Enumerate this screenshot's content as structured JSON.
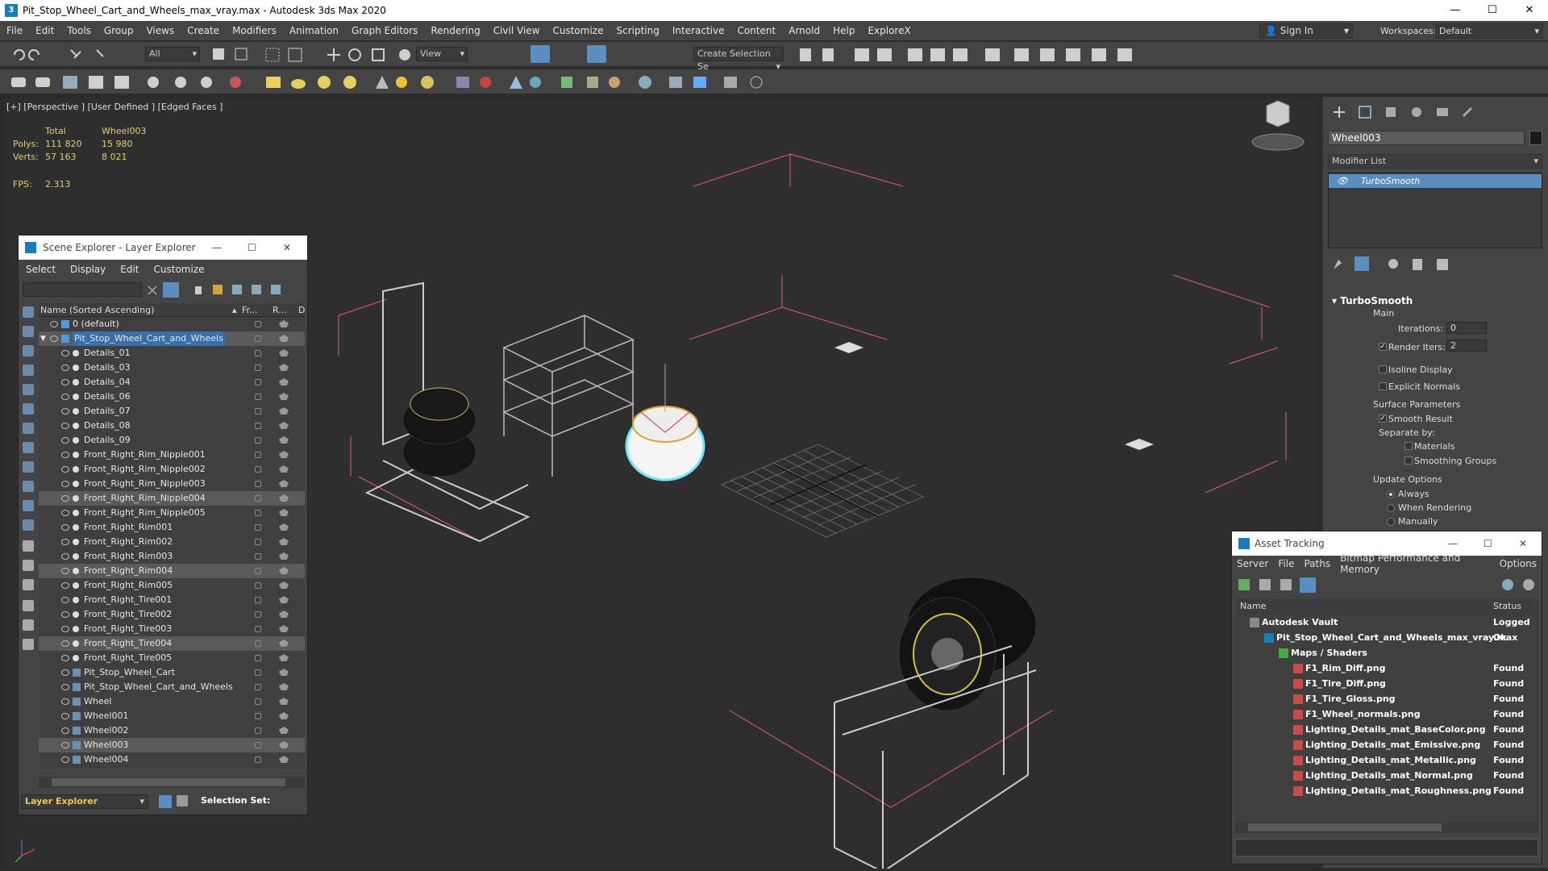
{
  "window": {
    "title": "Pit_Stop_Wheel_Cart_and_Wheels_max_vray.max - Autodesk 3ds Max 2020",
    "app_icon": "3"
  },
  "menu": [
    "File",
    "Edit",
    "Tools",
    "Group",
    "Views",
    "Create",
    "Modifiers",
    "Animation",
    "Graph Editors",
    "Rendering",
    "Civil View",
    "Customize",
    "Scripting",
    "Interactive",
    "Content",
    "Arnold",
    "Help",
    "ExploreX"
  ],
  "signin": {
    "label": "Sign In"
  },
  "workspaces": {
    "label": "Workspaces:",
    "value": "Default"
  },
  "toolbar": {
    "selection_filter": "All",
    "ref_coord": "View",
    "create_selection_set": "Create Selection Se"
  },
  "viewport": {
    "label": "[+] [Perspective ] [User Defined ] [Edged Faces ]",
    "stats": {
      "total_label": "Total",
      "object_label": "Wheel003",
      "polys_label": "Polys:",
      "polys_total": "111 820",
      "polys_obj": "15 980",
      "verts_label": "Verts:",
      "verts_total": "57 163",
      "verts_obj": "8 021",
      "fps_label": "FPS:",
      "fps_value": "2.313"
    }
  },
  "command_panel": {
    "object_name": "Wheel003",
    "modifier_list": "Modifier List",
    "stack_item": "TurboSmooth",
    "rollout": "TurboSmooth",
    "main_label": "Main",
    "iterations_label": "Iterations:",
    "iterations_value": "0",
    "render_iters_label": "Render Iters:",
    "render_iters_value": "2",
    "isoline_display": "Isoline Display",
    "explicit_normals": "Explicit Normals",
    "surface_parameters": "Surface Parameters",
    "smooth_result": "Smooth Result",
    "separate_by": "Separate by:",
    "materials": "Materials",
    "smoothing_groups": "Smoothing Groups",
    "update_options": "Update Options",
    "always": "Always",
    "when_rendering": "When Rendering",
    "manually": "Manually"
  },
  "scene_explorer": {
    "title": "Scene Explorer - Layer Explorer",
    "menu": [
      "Select",
      "Display",
      "Edit",
      "Customize"
    ],
    "col_name": "Name (Sorted Ascending)",
    "col_fr": "Fr...",
    "col_r": "R...",
    "col_d": "D",
    "rows": [
      {
        "name": "0 (default)",
        "indent": 0,
        "hl": false,
        "layer": true
      },
      {
        "name": "Pit_Stop_Wheel_Cart_and_Wheels",
        "indent": 0,
        "hl": true,
        "layer": true
      },
      {
        "name": "Details_01",
        "indent": 1,
        "hl": false
      },
      {
        "name": "Details_03",
        "indent": 1,
        "hl": false
      },
      {
        "name": "Details_04",
        "indent": 1,
        "hl": false
      },
      {
        "name": "Details_06",
        "indent": 1,
        "hl": false
      },
      {
        "name": "Details_07",
        "indent": 1,
        "hl": false
      },
      {
        "name": "Details_08",
        "indent": 1,
        "hl": false
      },
      {
        "name": "Details_09",
        "indent": 1,
        "hl": false
      },
      {
        "name": "Front_Right_Rim_Nipple001",
        "indent": 1,
        "hl": false
      },
      {
        "name": "Front_Right_Rim_Nipple002",
        "indent": 1,
        "hl": false
      },
      {
        "name": "Front_Right_Rim_Nipple003",
        "indent": 1,
        "hl": false
      },
      {
        "name": "Front_Right_Rim_Nipple004",
        "indent": 1,
        "hl": true
      },
      {
        "name": "Front_Right_Rim_Nipple005",
        "indent": 1,
        "hl": false
      },
      {
        "name": "Front_Right_Rim001",
        "indent": 1,
        "hl": false
      },
      {
        "name": "Front_Right_Rim002",
        "indent": 1,
        "hl": false
      },
      {
        "name": "Front_Right_Rim003",
        "indent": 1,
        "hl": false
      },
      {
        "name": "Front_Right_Rim004",
        "indent": 1,
        "hl": true
      },
      {
        "name": "Front_Right_Rim005",
        "indent": 1,
        "hl": false
      },
      {
        "name": "Front_Right_Tire001",
        "indent": 1,
        "hl": false
      },
      {
        "name": "Front_Right_Tire002",
        "indent": 1,
        "hl": false
      },
      {
        "name": "Front_Right_Tire003",
        "indent": 1,
        "hl": false
      },
      {
        "name": "Front_Right_Tire004",
        "indent": 1,
        "hl": true
      },
      {
        "name": "Front_Right_Tire005",
        "indent": 1,
        "hl": false
      },
      {
        "name": "Pit_Stop_Wheel_Cart",
        "indent": 1,
        "hl": false,
        "obj": true
      },
      {
        "name": "Pit_Stop_Wheel_Cart_and_Wheels",
        "indent": 1,
        "hl": false,
        "obj": true
      },
      {
        "name": "Wheel",
        "indent": 1,
        "hl": false,
        "obj": true
      },
      {
        "name": "Wheel001",
        "indent": 1,
        "hl": false,
        "obj": true
      },
      {
        "name": "Wheel002",
        "indent": 1,
        "hl": false,
        "obj": true
      },
      {
        "name": "Wheel003",
        "indent": 1,
        "hl": true,
        "obj": true
      },
      {
        "name": "Wheel004",
        "indent": 1,
        "hl": false,
        "obj": true
      }
    ],
    "bottom_combo": "Layer Explorer",
    "selection_set_label": "Selection Set:"
  },
  "asset_tracking": {
    "title": "Asset Tracking",
    "menu": [
      "Server",
      "File",
      "Paths",
      "Bitmap Performance and Memory",
      "Options"
    ],
    "col_name": "Name",
    "col_status": "Status",
    "rows": [
      {
        "name": "Autodesk Vault",
        "status": "Logged Or",
        "indent": 1,
        "kind": "vault"
      },
      {
        "name": "Pit_Stop_Wheel_Cart_and_Wheels_max_vray.max",
        "status": "Ok",
        "indent": 2,
        "kind": "max"
      },
      {
        "name": "Maps / Shaders",
        "status": "",
        "indent": 3,
        "kind": "folder"
      },
      {
        "name": "F1_Rim_Diff.png",
        "status": "Found",
        "indent": 4,
        "kind": "png"
      },
      {
        "name": "F1_Tire_Diff.png",
        "status": "Found",
        "indent": 4,
        "kind": "png"
      },
      {
        "name": "F1_Tire_Gloss.png",
        "status": "Found",
        "indent": 4,
        "kind": "png"
      },
      {
        "name": "F1_Wheel_normals.png",
        "status": "Found",
        "indent": 4,
        "kind": "png"
      },
      {
        "name": "Lighting_Details_mat_BaseColor.png",
        "status": "Found",
        "indent": 4,
        "kind": "png"
      },
      {
        "name": "Lighting_Details_mat_Emissive.png",
        "status": "Found",
        "indent": 4,
        "kind": "png"
      },
      {
        "name": "Lighting_Details_mat_Metallic.png",
        "status": "Found",
        "indent": 4,
        "kind": "png"
      },
      {
        "name": "Lighting_Details_mat_Normal.png",
        "status": "Found",
        "indent": 4,
        "kind": "png"
      },
      {
        "name": "Lighting_Details_mat_Roughness.png",
        "status": "Found",
        "indent": 4,
        "kind": "png"
      }
    ]
  },
  "colors": {
    "selection_blue": "#5b8ec0",
    "stat_yellow": "#e0d070",
    "bounding_pink": "#e05a7a",
    "selected_cyan": "#6fe6ff"
  }
}
